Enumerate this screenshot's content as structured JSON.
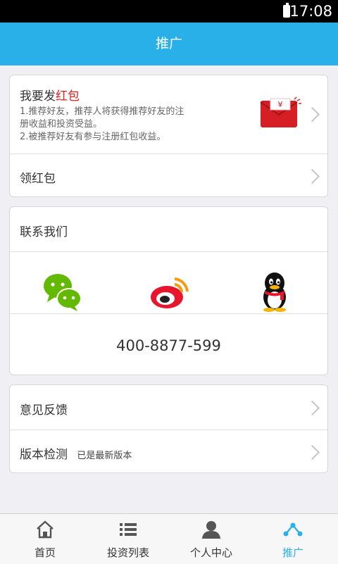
{
  "status_bar": {
    "time": "17:08"
  },
  "header": {
    "title": "推广"
  },
  "promo_card": {
    "title_prefix": "我要发",
    "title_highlight": "红包",
    "desc_line1": "1.推荐好友，推荐人将获得推荐好友的注",
    "desc_line2": "册收益和投资受益。",
    "desc_line3": " 2.被推荐好友有参与注册红包收益。",
    "redpacket_text": "¥",
    "receive_label": "领红包"
  },
  "contact_card": {
    "title": "联系我们",
    "icons": [
      "wechat-icon",
      "weibo-icon",
      "qq-icon"
    ],
    "phone": "400-8877-599"
  },
  "misc_card": {
    "feedback_label": "意见反馈",
    "version_label": "版本检测",
    "version_status": "已是最新版本"
  },
  "tabbar": {
    "tabs": [
      {
        "label": "首页",
        "icon": "home-icon"
      },
      {
        "label": "投资列表",
        "icon": "list-icon"
      },
      {
        "label": "个人中心",
        "icon": "user-icon"
      },
      {
        "label": "推广",
        "icon": "share-icon"
      }
    ],
    "active_index": 3
  },
  "colors": {
    "accent": "#2ab0e8",
    "highlight": "#e61c1c"
  }
}
